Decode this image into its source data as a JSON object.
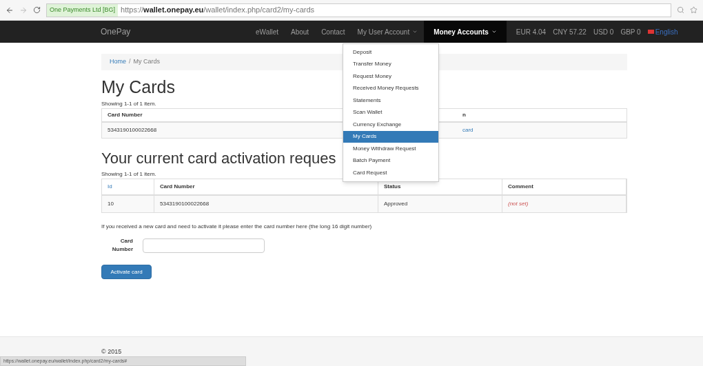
{
  "browser": {
    "security_label": "One Payments Ltd [BG]",
    "url_scheme": "https://",
    "url_host": "wallet.onepay.eu",
    "url_path": "/wallet/index.php/card2/my-cards"
  },
  "navbar": {
    "brand": "OnePay",
    "items": [
      {
        "label": "eWallet",
        "dropdown": false,
        "selected": false
      },
      {
        "label": "About",
        "dropdown": false,
        "selected": false
      },
      {
        "label": "Contact",
        "dropdown": false,
        "selected": false
      },
      {
        "label": "My User Account",
        "dropdown": true,
        "selected": false
      },
      {
        "label": "Money Accounts",
        "dropdown": true,
        "selected": true
      }
    ],
    "balances": [
      "EUR 4.04",
      "CNY 57.22",
      "USD 0",
      "GBP 0"
    ],
    "language": "English"
  },
  "menu": [
    {
      "label": "Deposit",
      "selected": false
    },
    {
      "label": "Transfer Money",
      "selected": false
    },
    {
      "label": "Request Money",
      "selected": false
    },
    {
      "label": "Received Money Requests",
      "selected": false
    },
    {
      "label": "Statements",
      "selected": false
    },
    {
      "label": "Scan Wallet",
      "selected": false
    },
    {
      "label": "Currency Exchange",
      "selected": false
    },
    {
      "label": "My Cards",
      "selected": true
    },
    {
      "label": "Money Withdraw Request",
      "selected": false
    },
    {
      "label": "Batch Payment",
      "selected": false
    },
    {
      "label": "Card Request",
      "selected": false
    }
  ],
  "breadcrumb": [
    "Home",
    "/",
    "My Cards"
  ],
  "cards": {
    "title": "My Cards",
    "summary": "Showing 1-1 of 1 item.",
    "columns": [
      "Card Number",
      "n"
    ],
    "rows": [
      [
        "5343190100022668",
        "card"
      ]
    ]
  },
  "requests": {
    "title": "Your current card activation reques",
    "summary": "Showing 1-1 of 1 item.",
    "columns": [
      "Id",
      "Card Number",
      "Status",
      "Comment"
    ],
    "rows": [
      [
        "10",
        "5343190100022668",
        "Approved",
        "(not set)"
      ]
    ]
  },
  "activation": {
    "hint": "If you received a new card and need to activate it please enter the card number here (the long 16 digit number)",
    "field_label": "Card Number",
    "button": "Activate card"
  },
  "footer": "© 2015",
  "status_url": "https://wallet.onepay.eu/wallet/index.php/card2/my-cards#"
}
